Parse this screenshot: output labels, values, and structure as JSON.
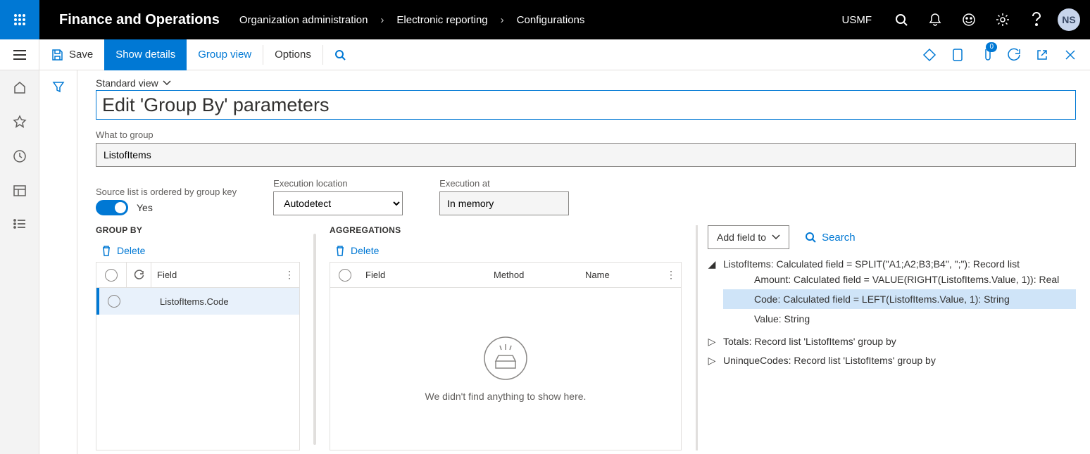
{
  "header": {
    "brand": "Finance and Operations",
    "breadcrumbs": [
      "Organization administration",
      "Electronic reporting",
      "Configurations"
    ],
    "entity": "USMF",
    "avatar": "NS"
  },
  "actionbar": {
    "save": "Save",
    "show_details": "Show details",
    "group_view": "Group view",
    "options": "Options",
    "badge": "0"
  },
  "page": {
    "view_label": "Standard view",
    "heading": "Edit 'Group By' parameters",
    "what_to_group_label": "What to group",
    "what_to_group_value": "ListofItems",
    "ordered_label": "Source list is ordered by group key",
    "ordered_value": "Yes",
    "exec_loc_label": "Execution location",
    "exec_loc_value": "Autodetect",
    "exec_at_label": "Execution at",
    "exec_at_value": "In memory"
  },
  "groupby": {
    "title": "GROUP BY",
    "delete": "Delete",
    "field_header": "Field",
    "rows": [
      {
        "field": "ListofItems.Code"
      }
    ]
  },
  "aggregations": {
    "title": "AGGREGATIONS",
    "delete": "Delete",
    "field_header": "Field",
    "method_header": "Method",
    "name_header": "Name",
    "empty": "We didn't find anything to show here."
  },
  "tree": {
    "add_field": "Add field to",
    "search": "Search",
    "root": "ListofItems: Calculated field = SPLIT(\"A1;A2;B3;B4\", \";\"): Record list",
    "children": [
      "Amount: Calculated field = VALUE(RIGHT(ListofItems.Value, 1)): Real",
      "Code: Calculated field = LEFT(ListofItems.Value, 1): String",
      "Value: String"
    ],
    "siblings": [
      "Totals: Record list 'ListofItems' group by",
      "UninqueCodes: Record list 'ListofItems' group by"
    ]
  }
}
